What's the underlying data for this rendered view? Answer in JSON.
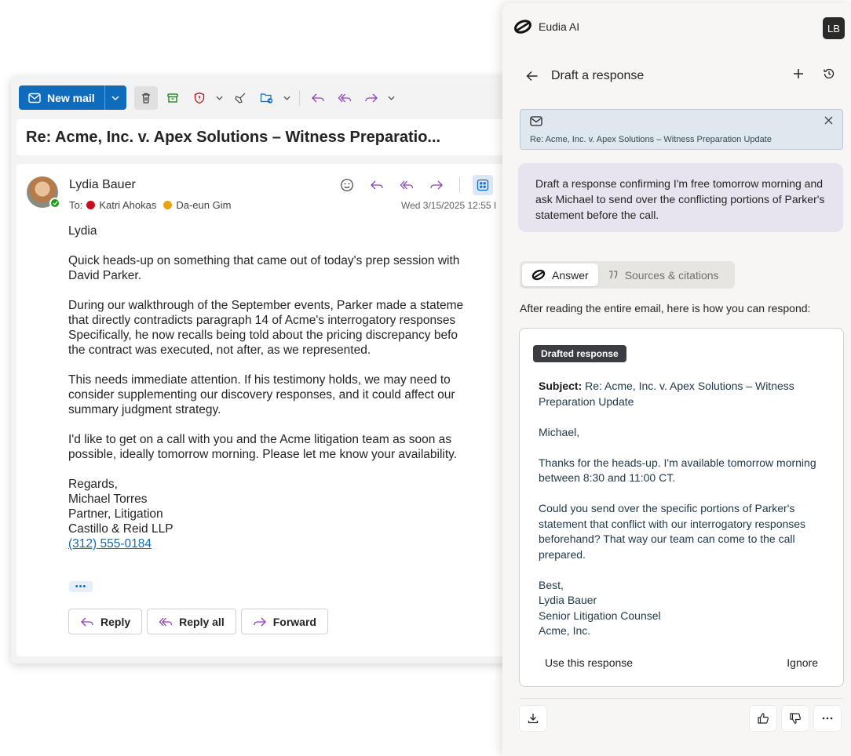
{
  "outlook": {
    "toolbar": {
      "new_mail_label": "New mail"
    },
    "subject": "Re: Acme, Inc. v. Apex Solutions – Witness Preparatio...",
    "message": {
      "sender": "Lydia Bauer",
      "to_label": "To:",
      "recipients": [
        {
          "name": "Katri Ahokas",
          "color": "#c50f1f"
        },
        {
          "name": "Da-eun Gim",
          "color": "#e8a317"
        }
      ],
      "date": "Wed 3/15/2025 12:55 I",
      "body": [
        "Lydia",
        "Quick heads-up on something that came out of today's prep session with\nDavid Parker.",
        "During our walkthrough of the September events, Parker made a stateme\nthat directly contradicts paragraph 14 of Acme's interrogatory responses\nSpecifically, he now recalls being told about the pricing discrepancy befo\nthe contract was executed, not after, as we represented.",
        "This needs immediate attention. If his testimony holds, we may need to\nconsider supplementing our discovery responses, and it could affect our\nsummary judgment strategy.",
        "I'd like to get on a call with you and the Acme litigation team as soon as\npossible, ideally tomorrow morning. Please let me know your availability."
      ],
      "signature": [
        "Regards,",
        "Michael Torres",
        "Partner, Litigation",
        "Castillo & Reid LLP"
      ],
      "phone": "(312) 555-0184",
      "more_label": "•••"
    },
    "actions": {
      "reply": "Reply",
      "reply_all": "Reply all",
      "forward": "Forward"
    }
  },
  "panel": {
    "app_name": "Eudia AI",
    "user_initials": "LB",
    "title": "Draft a response",
    "context_email": "Re: Acme, Inc. v. Apex Solutions – Witness Preparation Update",
    "prompt": "Draft a response confirming I'm free tomorrow morning and ask Michael to send over the conflicting portions of Parker's statement before the call.",
    "tabs": {
      "answer": "Answer",
      "sources": "Sources & citations"
    },
    "intro": "After reading the entire email, here is how you can respond:",
    "draft": {
      "badge": "Drafted response",
      "subject_label": "Subject:",
      "subject": "Re: Acme, Inc. v. Apex Solutions – Witness Preparation Update",
      "greeting": "Michael,",
      "para1": "Thanks for the heads-up. I'm available tomorrow morning between 8:30 and 11:00 CT.",
      "para2": "Could you send over the specific portions of Parker's statement that conflict with our interrogatory responses beforehand? That way our team can come to the call prepared.",
      "signoff": [
        "Best,",
        "Lydia Bauer",
        "Senior Litigation Counsel",
        "Acme, Inc."
      ],
      "use_label": "Use this response",
      "ignore_label": "Ignore"
    }
  },
  "colors": {
    "outlook_blue": "#0f6cbd",
    "reply_purple": "#8e3fb8"
  }
}
